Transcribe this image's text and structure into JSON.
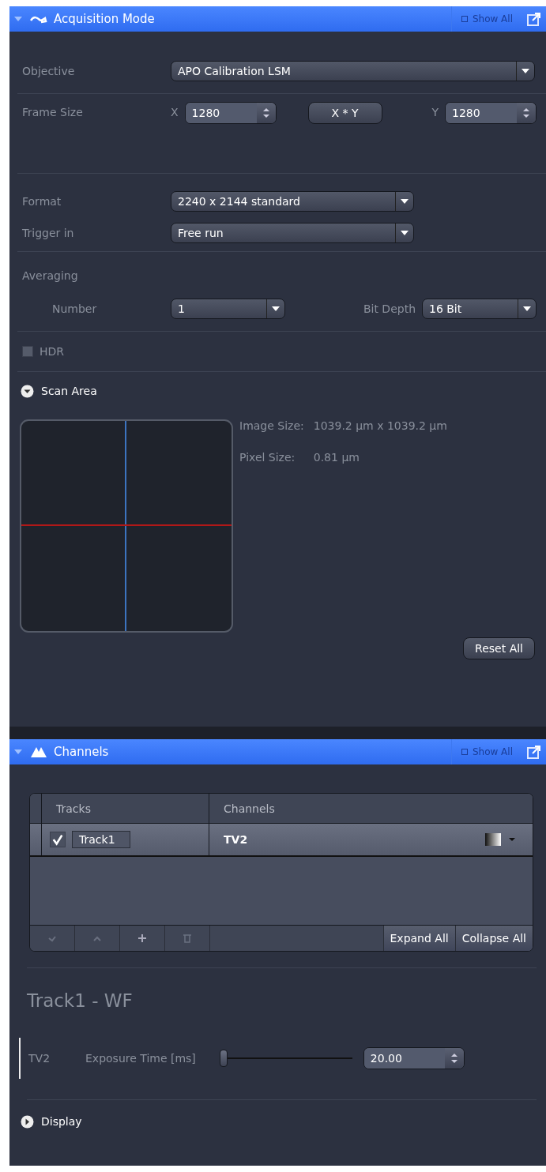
{
  "acquisition": {
    "title": "Acquisition Mode",
    "expanded": true,
    "show_all": "Show All",
    "objective": {
      "label": "Objective",
      "value": "APO Calibration LSM"
    },
    "frame_size": {
      "label": "Frame Size",
      "x_label": "X",
      "x_value": "1280",
      "link_button": "X * Y",
      "y_label": "Y",
      "y_value": "1280"
    },
    "format": {
      "label": "Format",
      "value": "2240 x 2144 standard"
    },
    "trigger": {
      "label": "Trigger in",
      "value": "Free run"
    },
    "averaging": {
      "label": "Averaging",
      "number_label": "Number",
      "number_value": "1",
      "bit_depth_label": "Bit Depth",
      "bit_depth_value": "16 Bit"
    },
    "hdr": {
      "label": "HDR",
      "checked": false
    },
    "scan_area": {
      "label": "Scan Area",
      "expanded": true,
      "image_size_label": "Image Size:",
      "image_size_value": "1039.2  µm x 1039.2  µm",
      "pixel_size_label": "Pixel Size:",
      "pixel_size_value": "0.81 µm",
      "reset_button": "Reset All"
    }
  },
  "channels": {
    "title": "Channels",
    "expanded": true,
    "show_all": "Show All",
    "table": {
      "columns": [
        "Tracks",
        "Channels"
      ],
      "rows": [
        {
          "checked": true,
          "track": "Track1",
          "channel": "TV2",
          "selected": true
        }
      ]
    },
    "expand_all": "Expand All",
    "collapse_all": "Collapse All",
    "track_title": "Track1 - WF",
    "exposure": {
      "channel": "TV2",
      "label": "Exposure Time [ms]",
      "level": 0,
      "value": "20.00"
    },
    "display": {
      "label": "Display",
      "expanded": false
    }
  }
}
